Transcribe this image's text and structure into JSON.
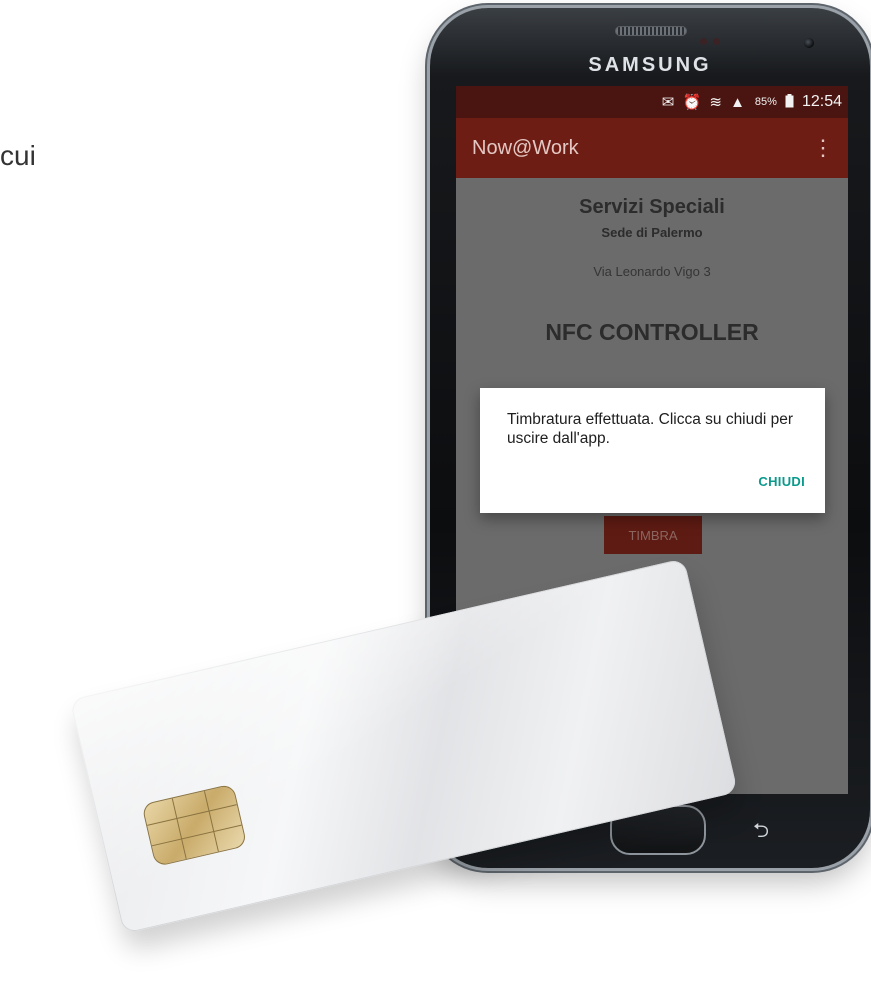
{
  "side_text": "cui",
  "phone": {
    "brand": "SAMSUNG",
    "status_bar": {
      "icons": "✉ ⏰ ≋ ▲",
      "battery": "85%",
      "time": "12:54"
    },
    "app_bar": {
      "title": "Now@Work",
      "overflow_icon": "⋮"
    },
    "content": {
      "title": "Servizi Speciali",
      "subtitle": "Sede di Palermo",
      "address": "Via Leonardo Vigo 3",
      "heading": "NFC CONTROLLER",
      "button_label": "TIMBRA"
    },
    "dialog": {
      "message": "Timbratura effettuata. Clicca su chiudi per uscire dall'app.",
      "button_label": "CHIUDI"
    },
    "nav": {
      "back_icon": "⮌"
    }
  },
  "colors": {
    "status_bar": "#4a1510",
    "app_bar": "#6d1d14",
    "app_title": "#e4c7c2",
    "screen_bg": "#6b6b6b",
    "dialog_button": "#0a9a8c",
    "timbra_button": "#5e1b13"
  }
}
